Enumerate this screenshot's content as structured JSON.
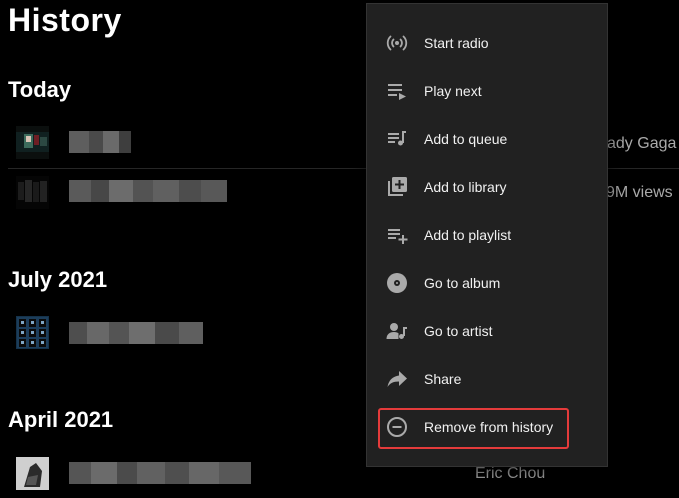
{
  "page": {
    "title": "History"
  },
  "sections": [
    {
      "heading": "Today"
    },
    {
      "heading": "July 2021"
    },
    {
      "heading": "April 2021"
    }
  ],
  "rows": {
    "row1_side": "ady Gaga",
    "row2_side": "9M views",
    "row5_side": "Eric Chou"
  },
  "menu": {
    "items": [
      {
        "label": "Start radio",
        "icon": "radio-icon"
      },
      {
        "label": "Play next",
        "icon": "play-next-icon"
      },
      {
        "label": "Add to queue",
        "icon": "queue-icon"
      },
      {
        "label": "Add to library",
        "icon": "library-add-icon"
      },
      {
        "label": "Add to playlist",
        "icon": "playlist-add-icon"
      },
      {
        "label": "Go to album",
        "icon": "album-icon"
      },
      {
        "label": "Go to artist",
        "icon": "artist-icon"
      },
      {
        "label": "Share",
        "icon": "share-icon"
      },
      {
        "label": "Remove from history",
        "icon": "remove-icon"
      }
    ]
  },
  "colors": {
    "background": "#000000",
    "menu_background": "#212121",
    "highlight": "#e53b3b"
  }
}
